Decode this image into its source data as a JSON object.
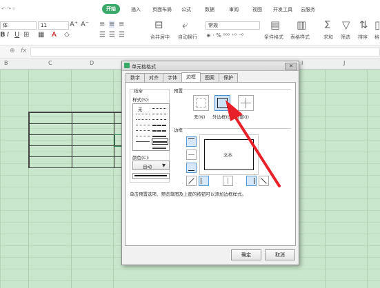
{
  "ribbon": {
    "tabs": [
      "开始",
      "插入",
      "页面布局",
      "公式",
      "数据",
      "审阅",
      "视图",
      "开发工具",
      "云服务"
    ],
    "font_name": "体",
    "font_size": "11",
    "number_format": "常规",
    "merge_label": "合并居中",
    "wrap_label": "自动换行",
    "cond_format_label": "条件格式",
    "table_style_label": "表格样式",
    "sum_label": "求和",
    "filter_label": "筛选",
    "sort_label": "排序",
    "format_label": "格"
  },
  "formula_bar": {
    "fx": "fx"
  },
  "columns": [
    "B",
    "C",
    "D",
    "I",
    "J"
  ],
  "dialog": {
    "title": "单元格格式",
    "tabs": [
      "数字",
      "对齐",
      "字体",
      "边框",
      "图案",
      "保护"
    ],
    "active_tab": "边框",
    "line_group": "线条",
    "style_label": "样式(S):",
    "style_none": "无",
    "color_label": "颜色(C):",
    "color_value": "自动",
    "preset_group": "预置",
    "preset_none": "无(N)",
    "preset_outline": "外边框(O)",
    "preset_inside": "内部(I)",
    "border_group": "边框",
    "preview_text": "文本",
    "hint": "单击预置选项、预览草图及上面的按钮可以添加边框样式。",
    "ok": "确定",
    "cancel": "取消"
  },
  "colors": {
    "accent": "#3aa868",
    "sheet": "#c9e7cc",
    "arrow": "#e8202a"
  }
}
